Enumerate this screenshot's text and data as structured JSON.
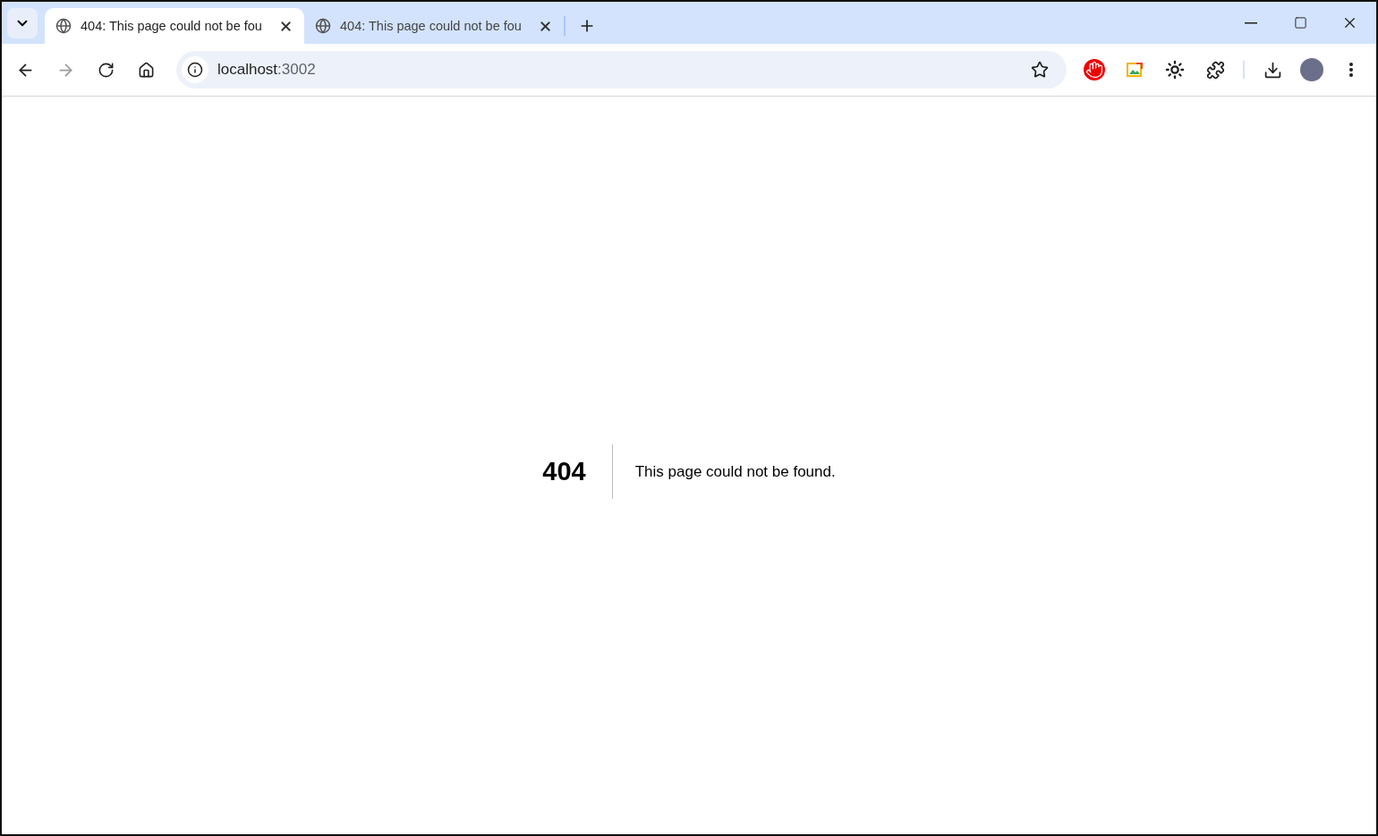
{
  "tabs": [
    {
      "title": "404: This page could not be fou",
      "selected": true
    },
    {
      "title": "404: This page could not be fou",
      "selected": false
    }
  ],
  "address_bar": {
    "host": "localhost",
    "port": ":3002"
  },
  "page": {
    "code": "404",
    "message": "This page could not be found."
  }
}
